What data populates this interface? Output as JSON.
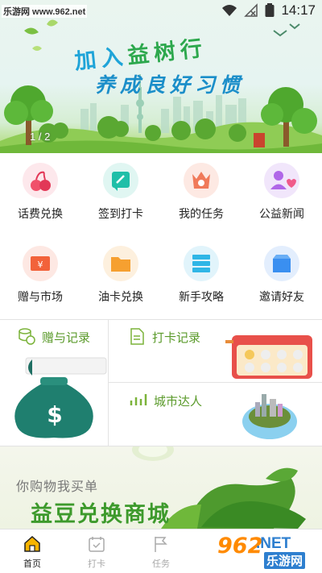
{
  "status_bar": {
    "watermark": "乐游网 www.962.net",
    "time": "14:17"
  },
  "banner": {
    "title_line1_a": "加入",
    "title_line1_b": "益树行",
    "title_line2": "养成良好习惯",
    "indicator": "1 / 2"
  },
  "grid": {
    "items": [
      {
        "label": "话费兑换",
        "icon": "cherry-icon",
        "color": "#f0506a"
      },
      {
        "label": "签到打卡",
        "icon": "edit-icon",
        "color": "#1fbfa8"
      },
      {
        "label": "我的任务",
        "icon": "crown-icon",
        "color": "#f07a5a"
      },
      {
        "label": "公益新闻",
        "icon": "heart-user-icon",
        "color": "#b067e8"
      },
      {
        "label": "赠与市场",
        "icon": "ticket-icon",
        "color": "#f2623a"
      },
      {
        "label": "油卡兑换",
        "icon": "folder-icon",
        "color": "#f6a030"
      },
      {
        "label": "新手攻略",
        "icon": "server-icon",
        "color": "#2fb6e6"
      },
      {
        "label": "邀请好友",
        "icon": "box-icon",
        "color": "#3a8ff0"
      }
    ]
  },
  "cards": {
    "gift_record": "赠与记录",
    "checkin_record": "打卡记录",
    "city_expert": "城市达人"
  },
  "promo": {
    "subtitle": "你购物我买单",
    "title": "益豆兑换商城"
  },
  "bottom_nav": {
    "items": [
      {
        "label": "首页",
        "active": true
      },
      {
        "label": "打卡",
        "active": false
      },
      {
        "label": "任务",
        "active": false
      }
    ]
  },
  "watermark_bottom": {
    "number": "962",
    "suffix": ".NET",
    "text": "乐游网"
  }
}
